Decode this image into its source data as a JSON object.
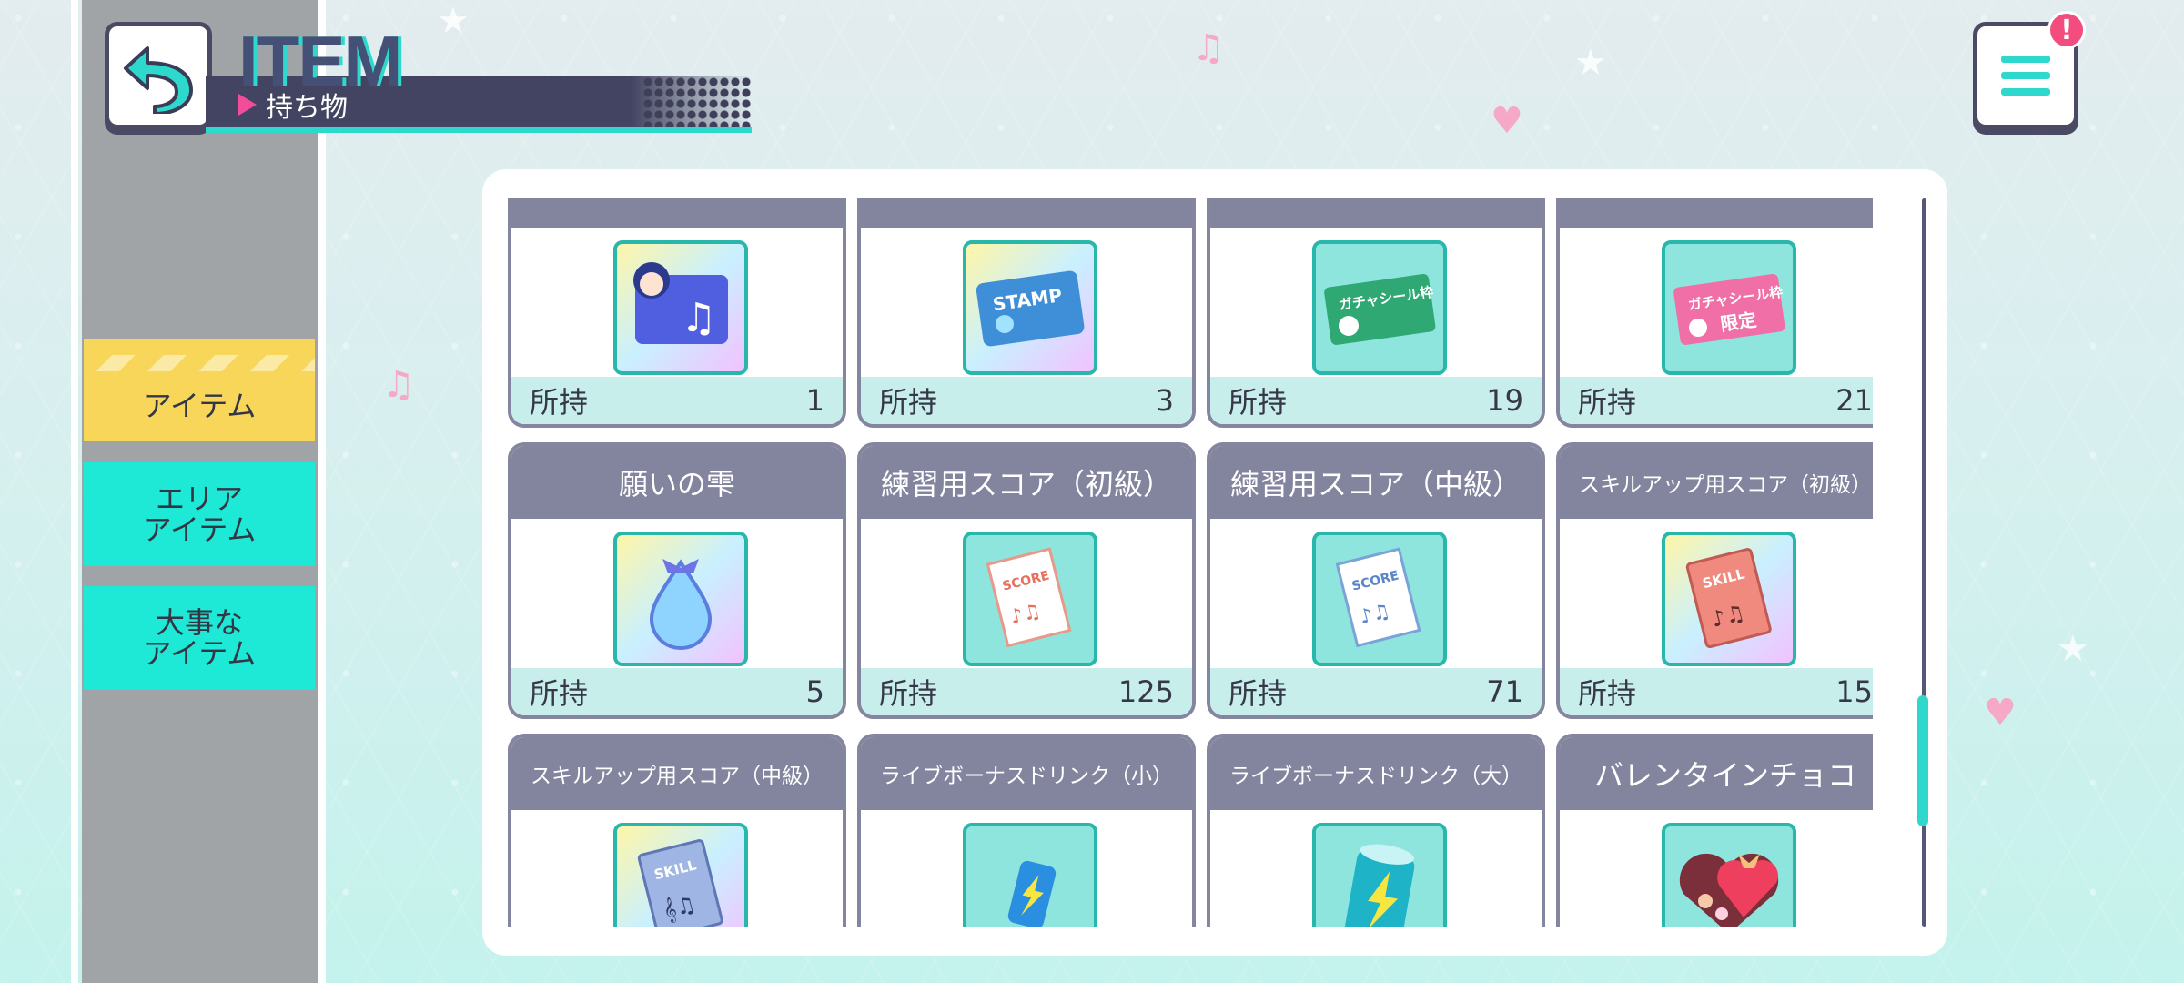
{
  "header": {
    "title_en": "ITEM",
    "title_jp": "持ち物",
    "notification_badge": "!"
  },
  "sidebar": {
    "tabs": [
      {
        "label": "アイテム",
        "active": true
      },
      {
        "label": "エリア\nアイテム",
        "active": false
      },
      {
        "label": "大事な\nアイテム",
        "active": false
      }
    ]
  },
  "items": {
    "owned_label": "所持",
    "cards": [
      {
        "name": "",
        "count": "1",
        "icon": "character-music-card-icon"
      },
      {
        "name": "",
        "count": "3",
        "icon": "stamp-ticket-icon"
      },
      {
        "name": "",
        "count": "19",
        "icon": "gacha-sticker-frame-icon"
      },
      {
        "name": "",
        "count": "21",
        "icon": "gacha-sticker-frame-limited-icon"
      },
      {
        "name": "願いの雫",
        "count": "5",
        "icon": "wish-drop-icon"
      },
      {
        "name": "練習用スコア（初級）",
        "count": "125",
        "icon": "practice-score-icon"
      },
      {
        "name": "練習用スコア（中級）",
        "count": "71",
        "icon": "practice-score-icon"
      },
      {
        "name": "スキルアップ用スコア（初級）",
        "count": "15",
        "icon": "skill-score-icon"
      },
      {
        "name": "スキルアップ用スコア（中級）",
        "count": "",
        "icon": "skill-score-icon"
      },
      {
        "name": "ライブボーナスドリンク（小）",
        "count": "",
        "icon": "drink-can-small-icon"
      },
      {
        "name": "ライブボーナスドリンク（大）",
        "count": "",
        "icon": "drink-can-large-icon"
      },
      {
        "name": "バレンタインチョコ",
        "count": "",
        "icon": "valentine-chocolate-icon"
      }
    ],
    "icon_texts": {
      "stamp": "STAMP",
      "gacha": "ガチャシール枠",
      "limited": "限定",
      "score": "SCORE",
      "skill": "SKILL"
    }
  },
  "colors": {
    "accent_teal": "#2fd8cc",
    "active_tab": "#f7d65a",
    "tab_teal": "#1de9d6",
    "card_header": "#83849e",
    "card_footer": "#c8eeeb",
    "navy": "#434461"
  }
}
